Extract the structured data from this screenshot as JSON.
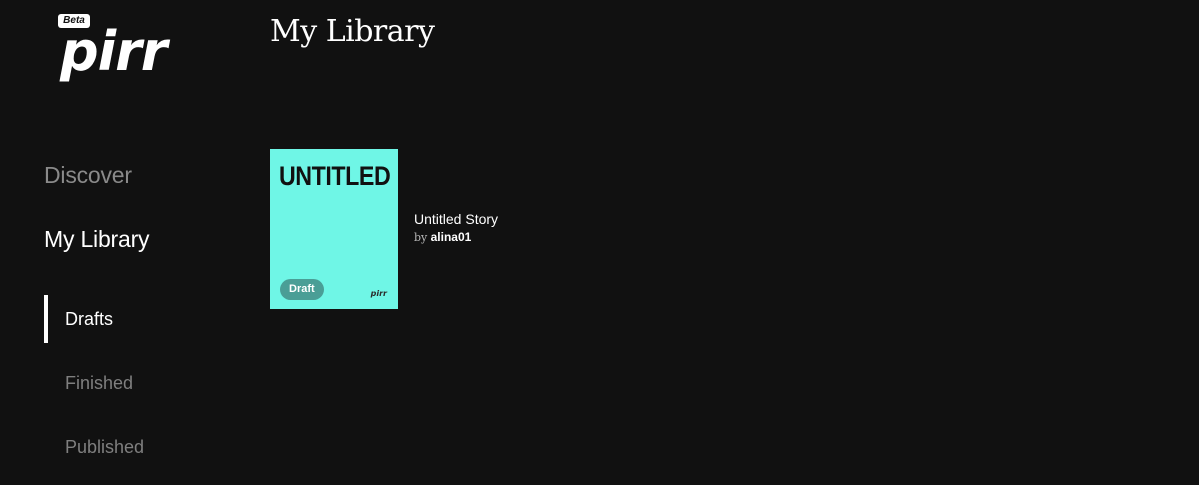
{
  "logo": {
    "badge": "Beta",
    "wordmark": "pirr"
  },
  "nav": {
    "discover": "Discover",
    "my_library": "My Library",
    "sub": [
      {
        "label": "Drafts",
        "active": true
      },
      {
        "label": "Finished",
        "active": false
      },
      {
        "label": "Published",
        "active": false
      }
    ]
  },
  "main": {
    "title": "My Library",
    "stories": [
      {
        "cover_title": "UNTITLED",
        "cover_mark": "pirr",
        "badge": "Draft",
        "title": "Untitled Story",
        "by": "by",
        "author": "alina01",
        "cover_color": "#6ff6e6"
      }
    ]
  },
  "colors": {
    "background": "#111111",
    "active_text": "#ffffff",
    "inactive_text": "#7f7f7f",
    "badge": "#4a9e96"
  }
}
